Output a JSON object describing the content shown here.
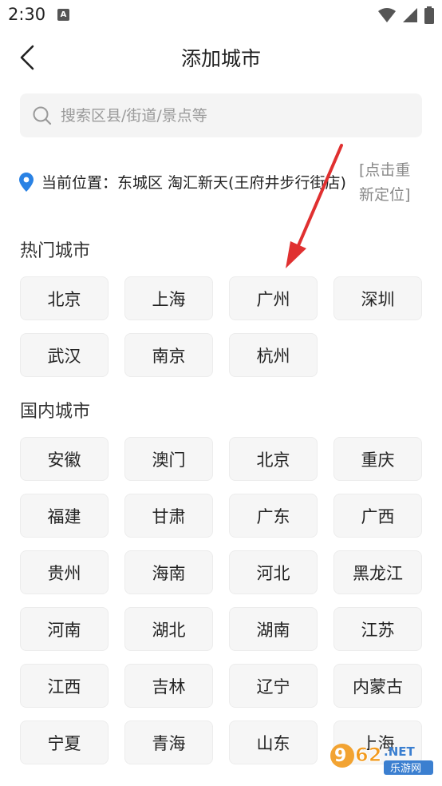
{
  "status_bar": {
    "time": "2:30",
    "notif_letter": "A"
  },
  "header": {
    "title": "添加城市"
  },
  "search": {
    "placeholder": "搜索区县/街道/景点等"
  },
  "location": {
    "text": "当前位置：东城区 淘汇新天(王府井步行街店)",
    "relocate_label": "[点击重新定位]"
  },
  "hot_cities": {
    "title": "热门城市",
    "items": [
      "北京",
      "上海",
      "广州",
      "深圳",
      "武汉",
      "南京",
      "杭州"
    ]
  },
  "domestic_cities": {
    "title": "国内城市",
    "items": [
      "安徽",
      "澳门",
      "北京",
      "重庆",
      "福建",
      "甘肃",
      "广东",
      "广西",
      "贵州",
      "海南",
      "河北",
      "黑龙江",
      "河南",
      "湖北",
      "湖南",
      "江苏",
      "江西",
      "吉林",
      "辽宁",
      "内蒙古",
      "宁夏",
      "青海",
      "山东",
      "上海"
    ]
  },
  "watermark": {
    "brand": "962",
    "suffix": ".NET",
    "sub": "乐游网"
  },
  "colors": {
    "accent": "#2a82e4",
    "arrow": "#e03030",
    "chip_bg": "#f6f6f6"
  }
}
